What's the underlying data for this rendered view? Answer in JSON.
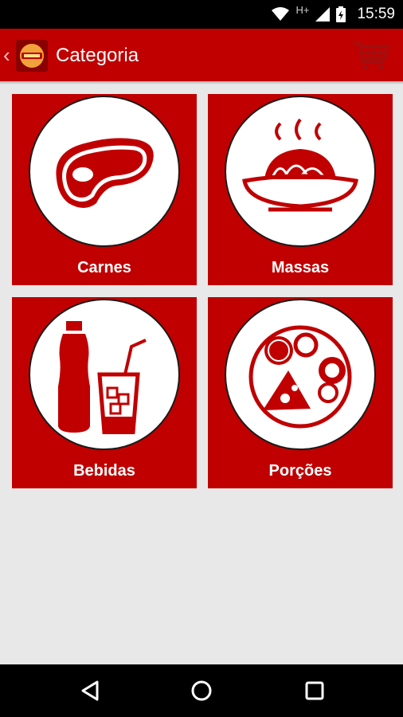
{
  "status_bar": {
    "network_label": "H+",
    "time": "15:59"
  },
  "app_bar": {
    "title": "Categoria",
    "icons": [
      "back-chevron-icon",
      "app-logo",
      "cart-icon"
    ]
  },
  "categories": [
    {
      "label": "Carnes",
      "icon": "steak-icon"
    },
    {
      "label": "Massas",
      "icon": "pasta-plate-icon"
    },
    {
      "label": "Bebidas",
      "icon": "drinks-icon"
    },
    {
      "label": "Porções",
      "icon": "platter-icon"
    }
  ],
  "nav_bar": {
    "icons": [
      "back-triangle-icon",
      "home-circle-icon",
      "recents-square-icon"
    ]
  },
  "colors": {
    "brand": "#c00000",
    "background": "#e8e8e8",
    "bars": "#000000"
  }
}
